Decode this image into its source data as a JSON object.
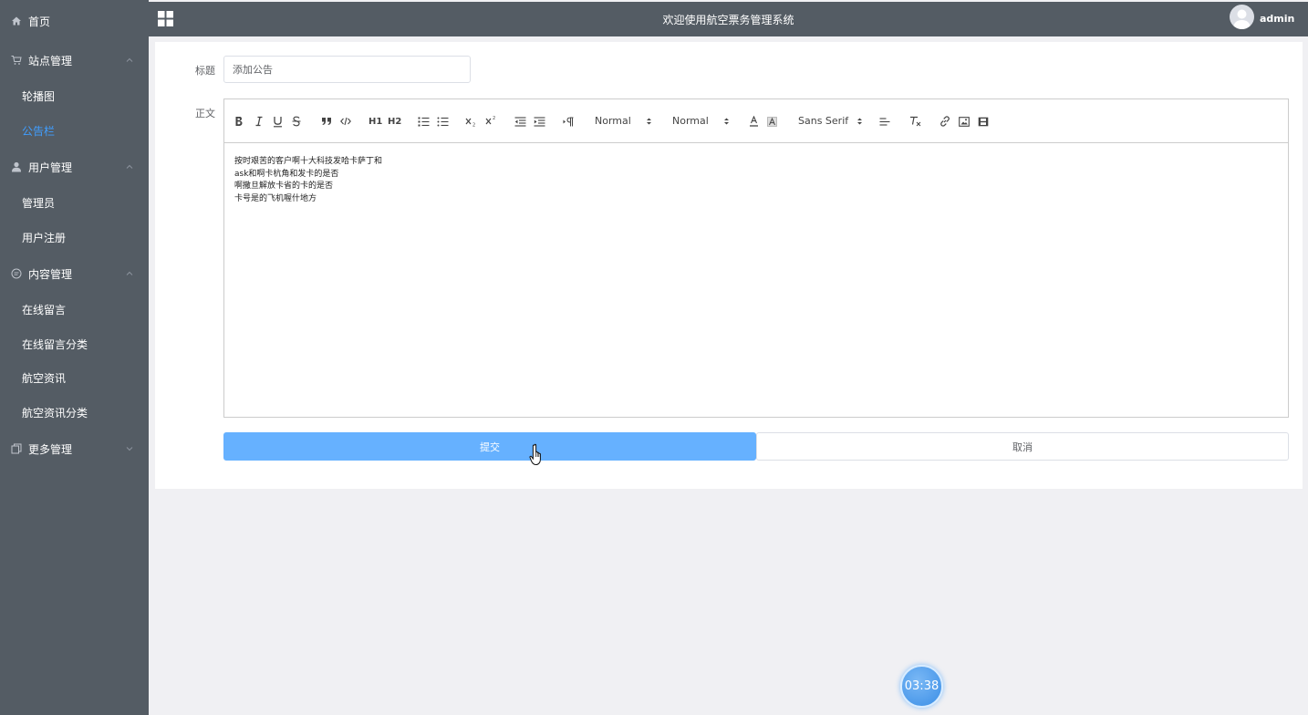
{
  "header": {
    "title": "欢迎使用航空票务管理系统",
    "username": "admin"
  },
  "sidebar": {
    "home": "首页",
    "groups": [
      {
        "label": "站点管理",
        "items": [
          "轮播图",
          "公告栏"
        ]
      },
      {
        "label": "用户管理",
        "items": [
          "管理员",
          "用户注册"
        ]
      },
      {
        "label": "内容管理",
        "items": [
          "在线留言",
          "在线留言分类",
          "航空资讯",
          "航空资讯分类"
        ]
      },
      {
        "label": "更多管理"
      }
    ],
    "active_item": "公告栏"
  },
  "form": {
    "title_label": "标题",
    "title_value": "添加公告",
    "body_label": "正文",
    "toolbar": {
      "header_picker": "Normal",
      "size_picker": "Normal",
      "font_picker": "Sans Serif",
      "h1": "H1",
      "h2": "H2"
    },
    "content_lines": [
      "按时艰苦的客户啊十大科技发哈卡萨丁和",
      "ask和啊卡杭角和发卡的是否",
      "啊撒旦解放卡省的卡的是否",
      "卡号是的飞机喔什地方"
    ],
    "submit_label": "提交",
    "cancel_label": "取消"
  },
  "timer": {
    "value": "03:38"
  },
  "colors": {
    "sidebar_bg": "#545c64",
    "active": "#409eff",
    "primary_button": "#66b1ff",
    "page_bg": "#f0f0f3"
  }
}
